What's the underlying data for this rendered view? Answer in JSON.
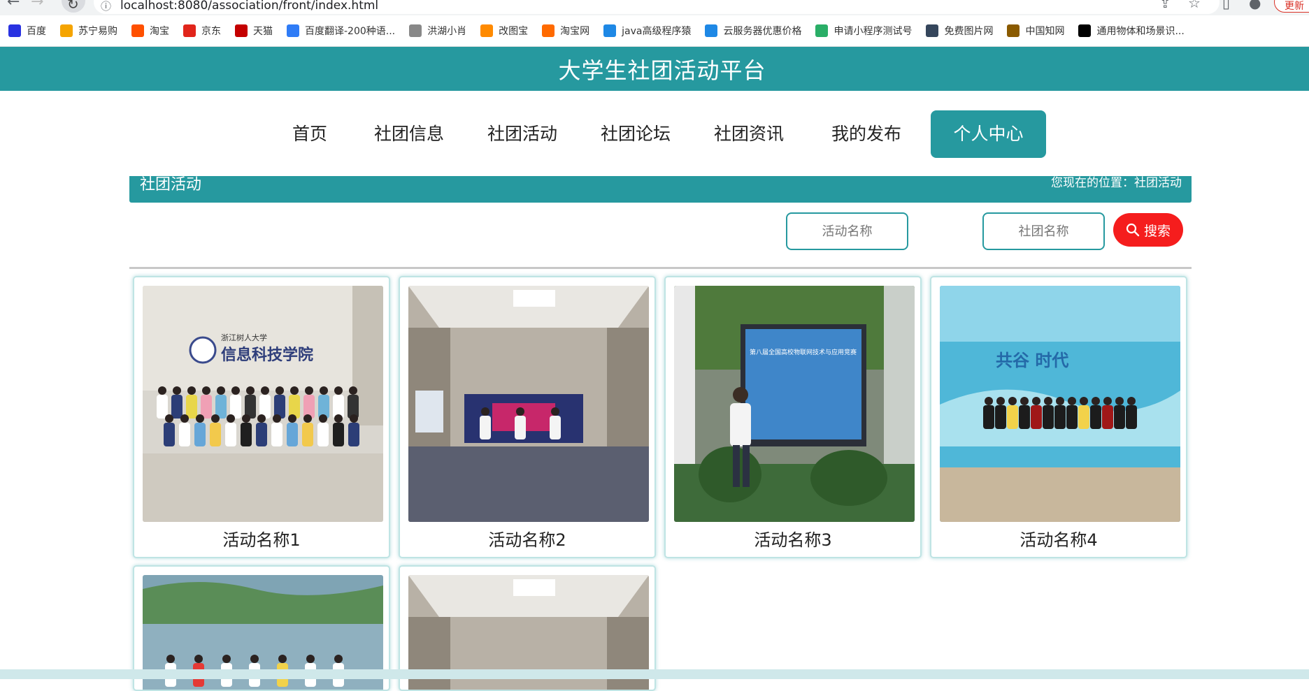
{
  "browser": {
    "url": "localhost:8080/association/front/index.html",
    "update_label": "更新",
    "bookmarks": [
      {
        "label": "百度",
        "icon": "baidu-paw-icon",
        "color": "#2932e1"
      },
      {
        "label": "苏宁易购",
        "icon": "suning-icon",
        "color": "#f5a400"
      },
      {
        "label": "淘宝",
        "icon": "taobao-icon",
        "color": "#ff5000"
      },
      {
        "label": "京东",
        "icon": "jd-icon",
        "color": "#e1251b"
      },
      {
        "label": "天猫",
        "icon": "tmall-icon",
        "color": "#c40000"
      },
      {
        "label": "百度翻译-200种语...",
        "icon": "translate-icon",
        "color": "#2f7cf6"
      },
      {
        "label": "洪湖小肖",
        "icon": "feather-icon",
        "color": "#888888"
      },
      {
        "label": "改图宝",
        "icon": "gaitubao-icon",
        "color": "#ff8a00"
      },
      {
        "label": "淘宝网",
        "icon": "taobao-net-icon",
        "color": "#ff6a00"
      },
      {
        "label": "java高级程序猿",
        "icon": "bilibili-icon",
        "color": "#1e88e5"
      },
      {
        "label": "云服务器优惠价格",
        "icon": "cloud-icon",
        "color": "#1e88e5"
      },
      {
        "label": "申请小程序测试号",
        "icon": "wechat-icon",
        "color": "#2aae67"
      },
      {
        "label": "免费图片网",
        "icon": "tumblr-icon",
        "color": "#35465c"
      },
      {
        "label": "中国知网",
        "icon": "cnki-icon",
        "color": "#8a5a00"
      },
      {
        "label": "通用物体和场景识...",
        "icon": "ai-icon",
        "color": "#000000"
      }
    ]
  },
  "site": {
    "title": "大学生社团活动平台"
  },
  "nav": [
    {
      "label": "首页",
      "active": false
    },
    {
      "label": "社团信息",
      "active": false
    },
    {
      "label": "社团活动",
      "active": false
    },
    {
      "label": "社团论坛",
      "active": false
    },
    {
      "label": "社团资讯",
      "active": false
    },
    {
      "label": "我的发布",
      "active": false
    },
    {
      "label": "个人中心",
      "active": true
    }
  ],
  "page": {
    "section_title": "社团活动",
    "location": "您现在的位置：社团活动"
  },
  "search": {
    "activity_placeholder": "活动名称",
    "club_placeholder": "社团名称",
    "button_label": "搜索"
  },
  "activities": [
    {
      "name": "活动名称1"
    },
    {
      "name": "活动名称2"
    },
    {
      "name": "活动名称3"
    },
    {
      "name": "活动名称4"
    },
    {
      "name": ""
    },
    {
      "name": ""
    }
  ],
  "photo_text": {
    "card1_sign": "信息科技学院",
    "card1_sign_top": "浙江树人大学",
    "card3_screen": "第八届全国高校物联网技术与应用竞赛",
    "card4_banner": "共谷  时代"
  },
  "colors": {
    "primary": "#26999f",
    "search_button": "#f51d1d"
  }
}
